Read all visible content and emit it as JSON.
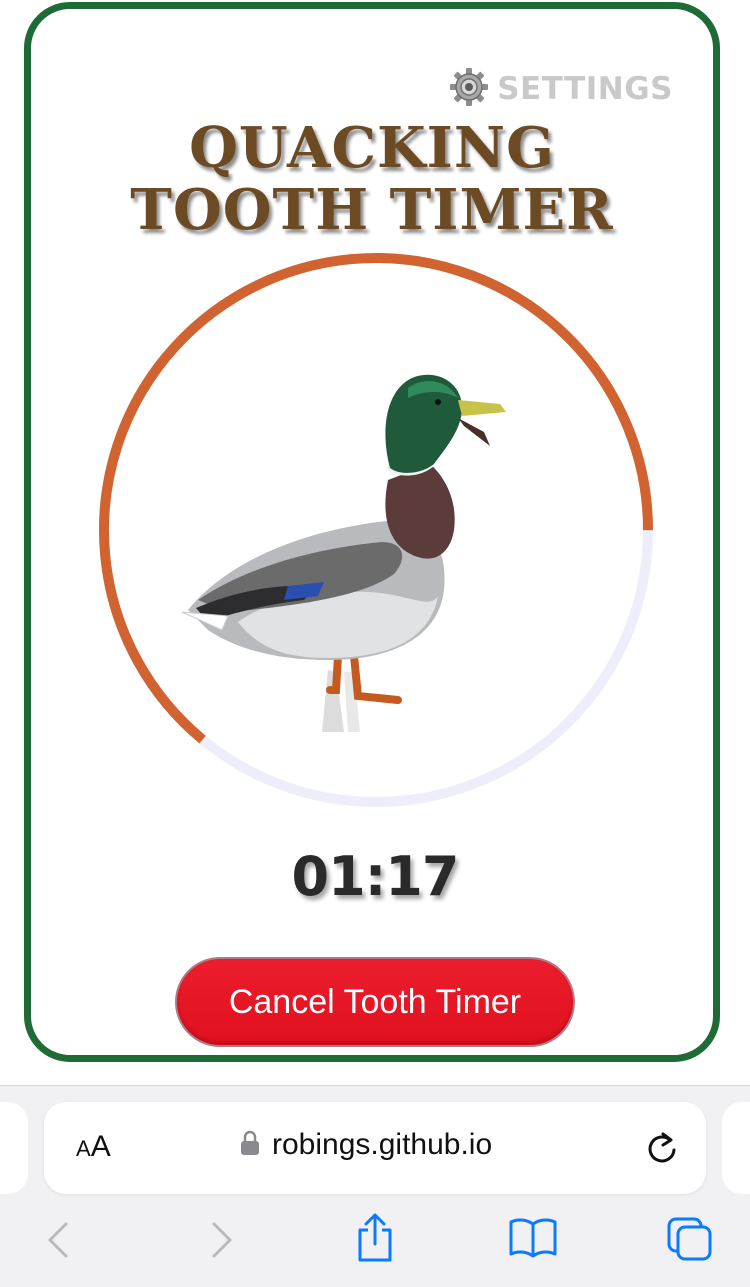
{
  "app": {
    "settings_label": "Settings",
    "title": "Quacking Tooth Timer",
    "timer": "01:17",
    "progress_fraction": 0.64,
    "cancel_button_label": "Cancel Tooth Timer",
    "colors": {
      "border": "#1e6b36",
      "title": "#6b4a24",
      "progress": "#d0632f",
      "track": "#eeeefb",
      "cancel": "#e8131f",
      "settings": "#c9c9c9"
    }
  },
  "browser": {
    "text_size_small": "A",
    "text_size_big": "A",
    "url": "robings.github.io",
    "icons": [
      "lock-icon",
      "reload-icon",
      "back-icon",
      "forward-icon",
      "share-icon",
      "bookmarks-icon",
      "tabs-icon"
    ],
    "accent": "#0a7aff"
  }
}
